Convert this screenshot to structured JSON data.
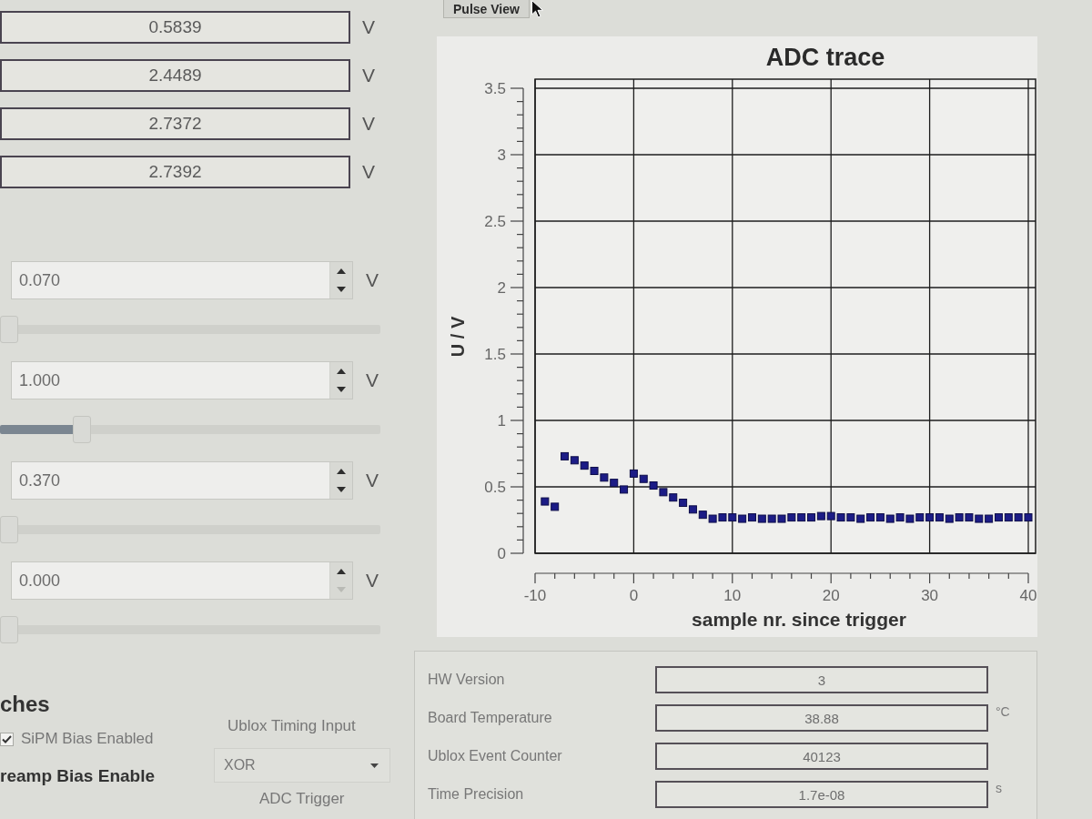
{
  "tabs": [
    {
      "label": "Pulse View",
      "selected": true
    }
  ],
  "readouts": [
    {
      "value": "0.5839",
      "unit": "V"
    },
    {
      "value": "2.4489",
      "unit": "V"
    },
    {
      "value": "2.7372",
      "unit": "V"
    },
    {
      "value": "2.7392",
      "unit": "V"
    }
  ],
  "setpoints": [
    {
      "value": "0.070",
      "unit": "V",
      "down_enabled": true,
      "level": 0
    },
    {
      "value": "1.000",
      "unit": "V",
      "down_enabled": true,
      "level": 0.2
    },
    {
      "value": "0.370",
      "unit": "V",
      "down_enabled": true,
      "level": 0
    },
    {
      "value": "0.000",
      "unit": "V",
      "down_enabled": false,
      "level": 0
    }
  ],
  "plot": {
    "chart_data": {
      "type": "scatter",
      "title": "ADC trace",
      "xlabel": "sample nr. since trigger",
      "ylabel": "U / V",
      "x": [
        -9,
        -8,
        -7,
        -6,
        -5,
        -4,
        -3,
        -2,
        -1,
        0,
        1,
        2,
        3,
        4,
        5,
        6,
        7,
        8,
        9,
        10,
        11,
        12,
        13,
        14,
        15,
        16,
        17,
        18,
        19,
        20,
        21,
        22,
        23,
        24,
        25,
        26,
        27,
        28,
        29,
        30,
        31,
        32,
        33,
        34,
        35,
        36,
        37,
        38,
        39,
        40
      ],
      "values": [
        0.39,
        0.35,
        0.73,
        0.7,
        0.66,
        0.62,
        0.57,
        0.53,
        0.48,
        0.6,
        0.56,
        0.51,
        0.46,
        0.42,
        0.38,
        0.33,
        0.29,
        0.26,
        0.27,
        0.27,
        0.26,
        0.27,
        0.26,
        0.26,
        0.26,
        0.27,
        0.27,
        0.27,
        0.28,
        0.28,
        0.27,
        0.27,
        0.26,
        0.27,
        0.27,
        0.26,
        0.27,
        0.26,
        0.27,
        0.27,
        0.27,
        0.26,
        0.27,
        0.27,
        0.26,
        0.26,
        0.27,
        0.27,
        0.27,
        0.27
      ],
      "xlim": [
        -10,
        40
      ],
      "ylim": [
        0,
        3.5
      ],
      "xticks": [
        -10,
        0,
        10,
        20,
        30,
        40
      ],
      "yticks": [
        0,
        0.5,
        1,
        1.5,
        2,
        2.5,
        3,
        3.5
      ],
      "grid": true
    }
  },
  "switches": {
    "heading": "ches",
    "items": [
      {
        "kind": "checkbox",
        "label": "SiPM Bias Enabled",
        "checked": true
      },
      {
        "kind": "label",
        "label": "reamp Bias Enable"
      }
    ]
  },
  "timing": {
    "label": "Ublox Timing Input",
    "value": "XOR",
    "trigger_label": "ADC Trigger"
  },
  "status": [
    {
      "label": "HW Version",
      "value": "3"
    },
    {
      "label": "Board Temperature",
      "value": "38.88",
      "unit": "°C"
    },
    {
      "label": "Ublox Event Counter",
      "value": "40123"
    },
    {
      "label": "Time Precision",
      "value": "1.7e-08",
      "unit": "s"
    }
  ]
}
